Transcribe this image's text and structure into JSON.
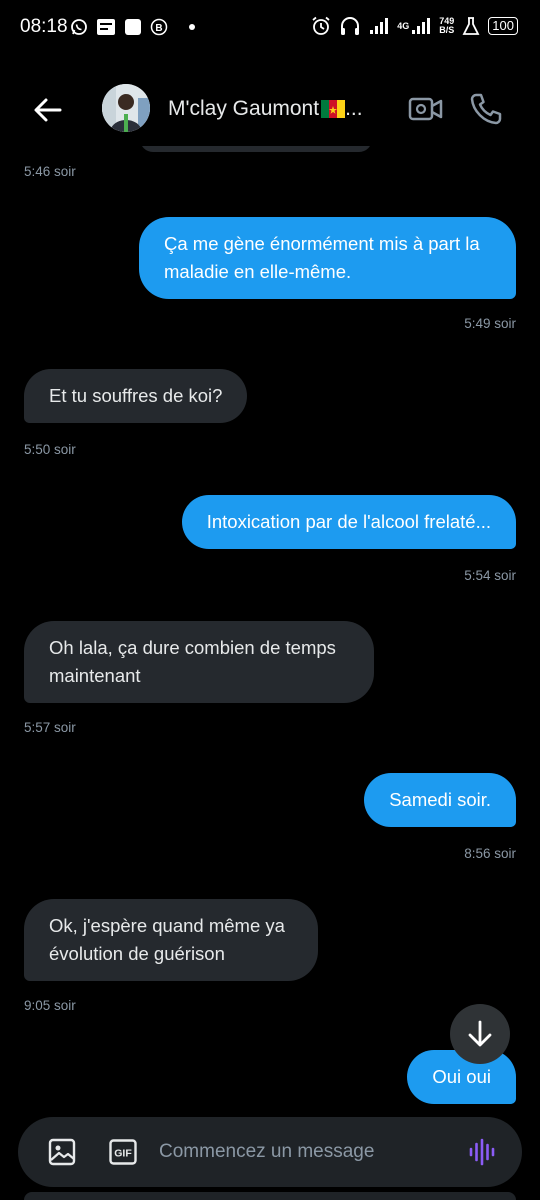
{
  "status_bar": {
    "time": "08:18",
    "network_type": "4G",
    "net_speed_value": "749",
    "net_speed_unit": "B/S",
    "battery": "100",
    "icons": [
      "whatsapp-icon",
      "notification-icon",
      "square-icon",
      "b-icon",
      "alarm-icon",
      "headset-icon",
      "signal-icon",
      "lab-icon"
    ]
  },
  "header": {
    "contact_name": "M'clay Gaumont",
    "name_suffix": "...",
    "back_icon": "arrow-left-icon",
    "video_icon": "video-call-icon",
    "phone_icon": "phone-icon"
  },
  "messages": [
    {
      "direction": "in",
      "text": "",
      "time": "5:46 soir"
    },
    {
      "direction": "out",
      "text": "Ça me gène énormément mis à part la maladie en elle-même.",
      "time": "5:49 soir"
    },
    {
      "direction": "in",
      "text": "Et tu souffres de koi?",
      "time": "5:50 soir"
    },
    {
      "direction": "out",
      "text": "Intoxication par de l'alcool frelaté...",
      "time": "5:54 soir"
    },
    {
      "direction": "in",
      "text": "Oh lala, ça dure combien de temps maintenant",
      "time": "5:57 soir"
    },
    {
      "direction": "out",
      "text": "Samedi soir.",
      "time": "8:56 soir"
    },
    {
      "direction": "in",
      "text": "Ok, j'espère quand même ya évolution de guérison",
      "time": "9:05 soir"
    },
    {
      "direction": "out",
      "text": "Oui oui",
      "time": ""
    }
  ],
  "composer": {
    "placeholder": "Commencez un message",
    "gif_label": "GIF",
    "icons": [
      "image-icon",
      "gif-icon",
      "voice-message-icon"
    ]
  },
  "colors": {
    "outgoing_bubble": "#1d9bf0",
    "incoming_bubble": "#25292e",
    "voice_accent": "#8b5cf6",
    "timestamp": "#8b98a5"
  }
}
